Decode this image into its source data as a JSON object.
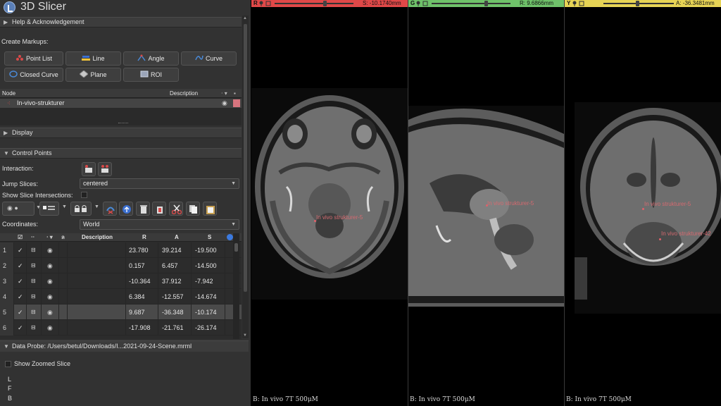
{
  "app": {
    "title": "3D Slicer"
  },
  "sections": {
    "help": "Help & Acknowledgement",
    "display": "Display",
    "control_points": "Control Points",
    "data_probe": "Data Probe: /Users/betul/Downloads/I...2021-09-24-Scene.mrml"
  },
  "create_markups": {
    "label": "Create Markups:",
    "buttons": [
      "Point List",
      "Line",
      "Angle",
      "Curve",
      "Closed Curve",
      "Plane",
      "ROI"
    ]
  },
  "node_table": {
    "col_node": "Node",
    "col_description": "Description",
    "row_name": "In-vivo-strukturer",
    "row_color": "#d8747e"
  },
  "control_points": {
    "interaction_label": "Interaction:",
    "jump_slices_label": "Jump Slices:",
    "jump_slices_value": "centered",
    "show_slice_intersections_label": "Show Slice Intersections:",
    "coordinates_label": "Coordinates:",
    "coordinates_value": "World",
    "columns": [
      "Description",
      "R",
      "A",
      "S"
    ],
    "rows": [
      {
        "num": "1",
        "R": "23.780",
        "A": "39.214",
        "S": "-19.500"
      },
      {
        "num": "2",
        "R": "0.157",
        "A": "6.457",
        "S": "-14.500"
      },
      {
        "num": "3",
        "R": "-10.364",
        "A": "37.912",
        "S": "-7.942"
      },
      {
        "num": "4",
        "R": "6.384",
        "A": "-12.557",
        "S": "-14.674"
      },
      {
        "num": "5",
        "R": "9.687",
        "A": "-36.348",
        "S": "-10.174"
      },
      {
        "num": "6",
        "R": "-17.908",
        "A": "-21.761",
        "S": "-26.174"
      }
    ]
  },
  "bottom": {
    "show_zoomed_slice": "Show Zoomed Slice",
    "orient": [
      "L",
      "F",
      "B"
    ]
  },
  "viewers": {
    "red": {
      "tag": "R",
      "offset": "S: -10.1740mm",
      "bar_color": "#e04848",
      "bottom_label": "B: In vivo 7T 500μM",
      "marker": "In vivo strukturer-5"
    },
    "green": {
      "tag": "G",
      "offset": "R: 9.6866mm",
      "bar_color": "#6fc26a",
      "bottom_label": "B: In vivo 7T 500μM",
      "marker": "In vivo strukturer-5"
    },
    "yellow": {
      "tag": "Y",
      "offset": "A: -36.3481mm",
      "bar_color": "#e7d455",
      "bottom_label": "B: In vivo 7T 500μM",
      "marker": "In vivo strukturer-5",
      "marker2": "In vivo strukturer-42"
    }
  }
}
